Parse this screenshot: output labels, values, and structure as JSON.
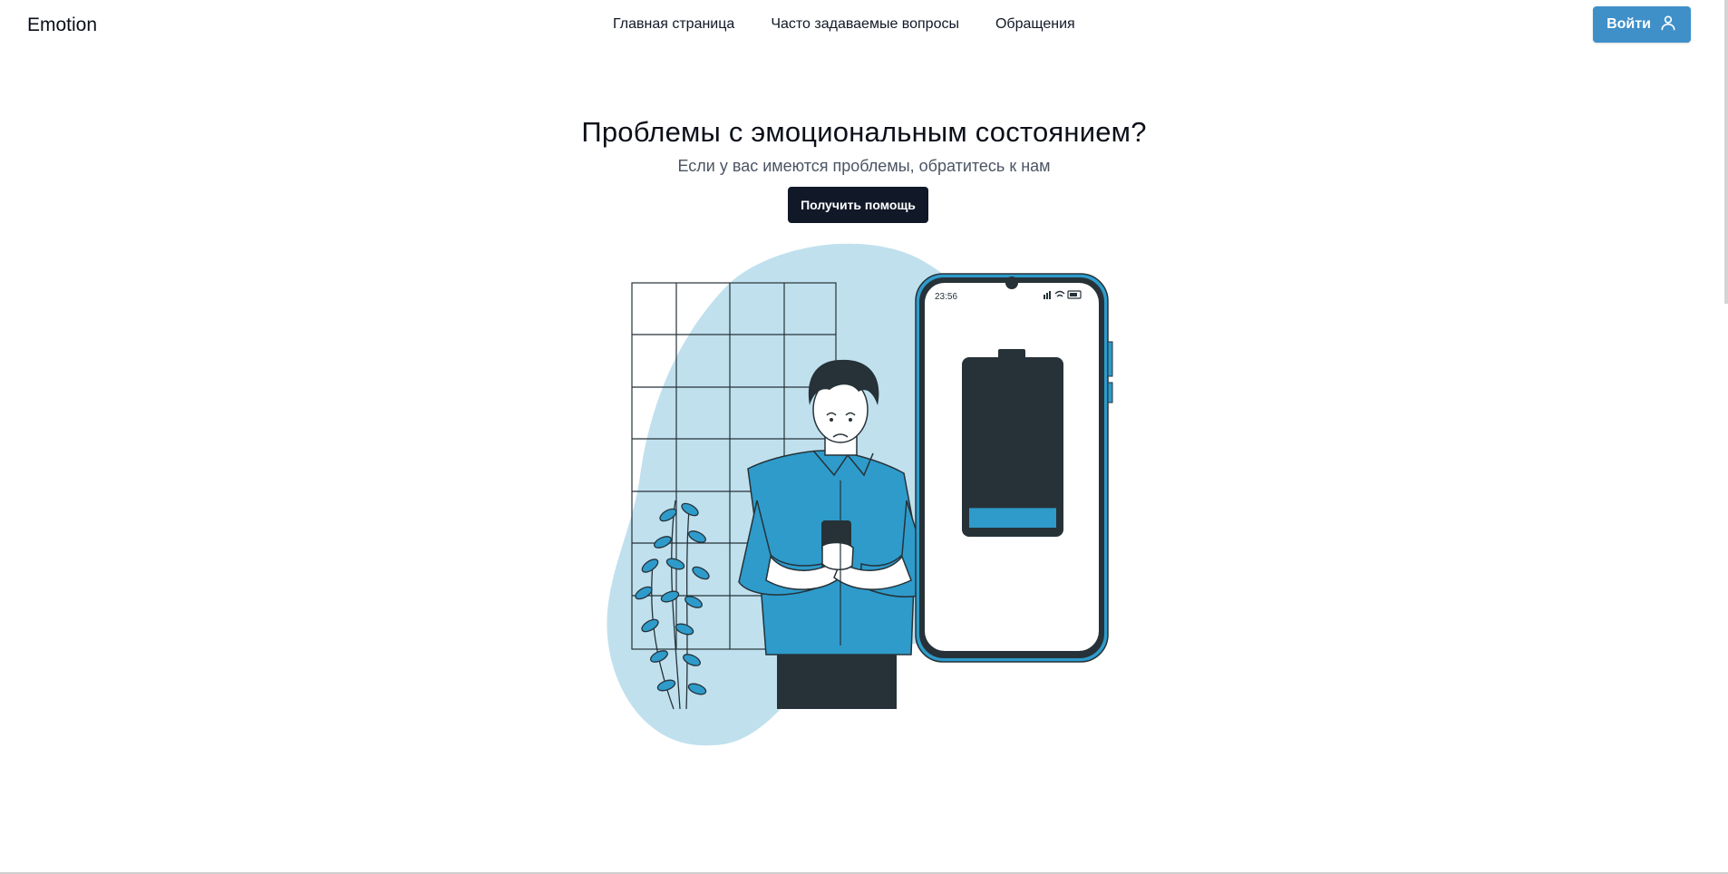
{
  "brand": {
    "name": "Emotion"
  },
  "nav": {
    "items": [
      {
        "label": "Главная страница"
      },
      {
        "label": "Часто задаваемые вопросы"
      },
      {
        "label": "Обращения"
      }
    ]
  },
  "login": {
    "label": "Войти",
    "icon": "user-icon"
  },
  "hero": {
    "title": "Проблемы с эмоциональным состоянием?",
    "subtitle": "Если у вас имеются проблемы, обратитесь к нам",
    "cta_label": "Получить помощь"
  },
  "illustration": {
    "phone_time": "23:56",
    "battery_level": 0.12
  },
  "colors": {
    "accent": "#3f8fc9",
    "dark_button": "#111827",
    "blob": "#c0e0ee",
    "shirt": "#2e9bcb",
    "ink": "#263238"
  }
}
